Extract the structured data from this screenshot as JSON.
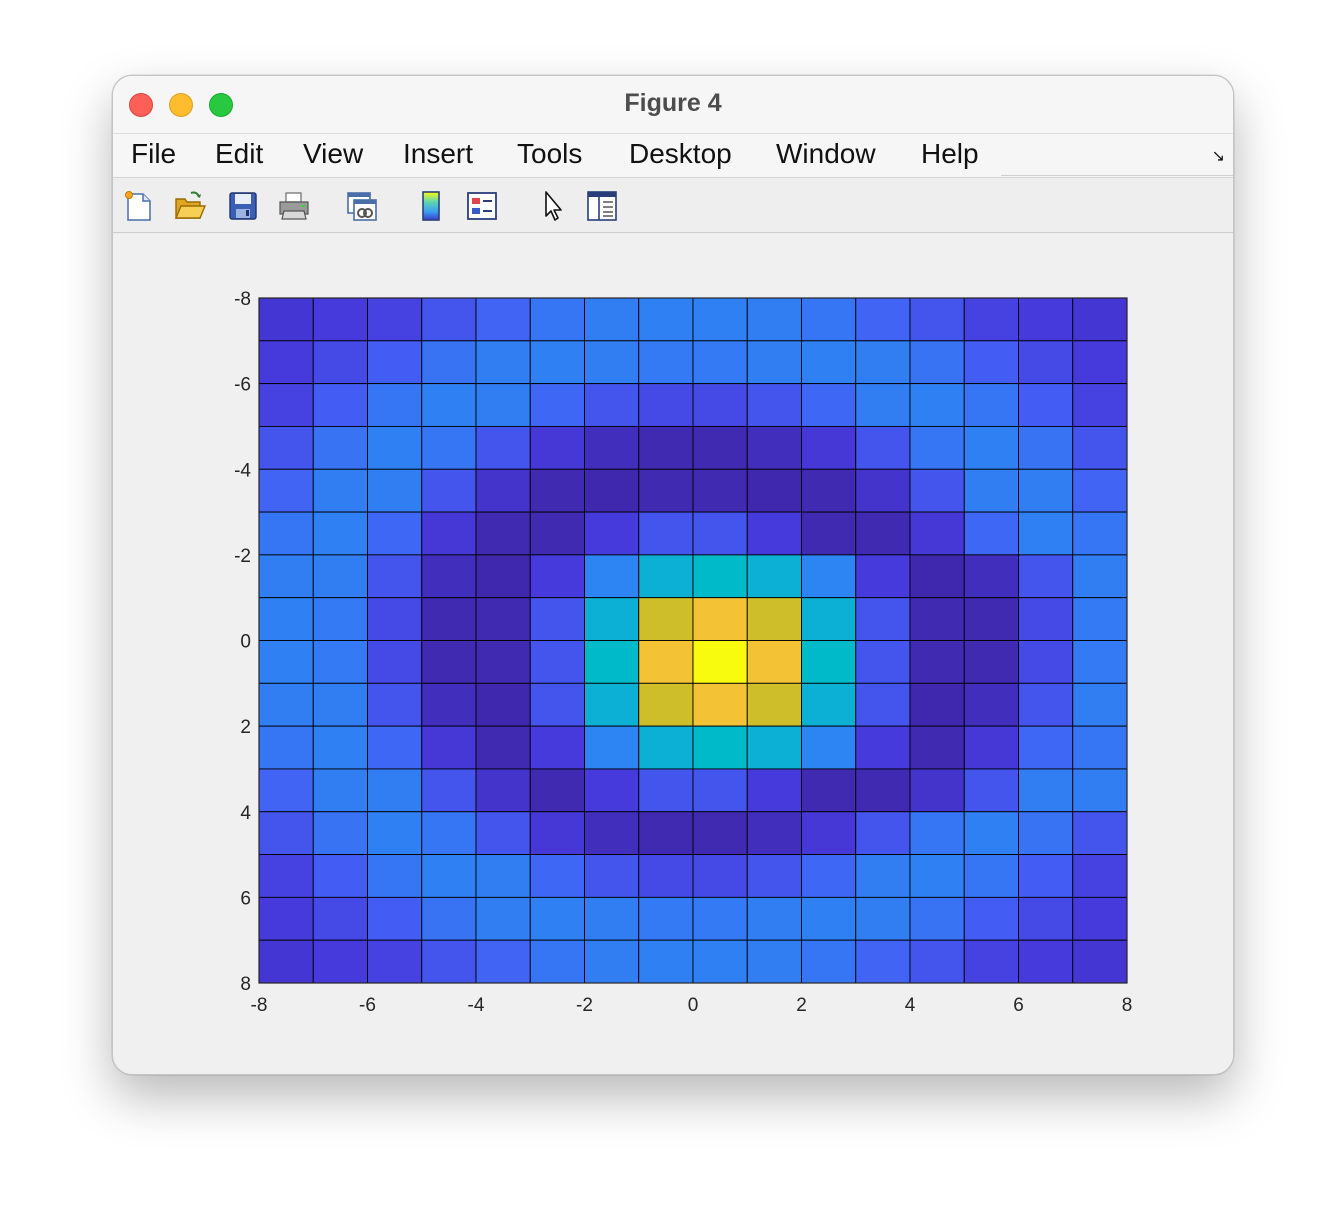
{
  "window": {
    "title": "Figure 4"
  },
  "menu": {
    "items": [
      "File",
      "Edit",
      "View",
      "Insert",
      "Tools",
      "Desktop",
      "Window",
      "Help"
    ]
  },
  "toolbar": {
    "icons": [
      "new-figure-icon",
      "open-file-icon",
      "save-icon",
      "print-icon",
      "link-plot-icon",
      "insert-colorbar-icon",
      "insert-legend-icon",
      "edit-plot-pointer-icon",
      "property-inspector-icon"
    ]
  },
  "chart_data": {
    "type": "heatmap",
    "title": "",
    "xlabel": "",
    "ylabel": "",
    "xlim": [
      -8,
      8
    ],
    "ylim": [
      -8,
      8
    ],
    "y_direction": "reversed",
    "grid": true,
    "colormap": "parula",
    "xticks": [
      -8,
      -6,
      -4,
      -2,
      0,
      2,
      4,
      6,
      8
    ],
    "yticks": [
      -8,
      -6,
      -4,
      -2,
      0,
      2,
      4,
      6,
      8
    ],
    "x_edges": [
      -8,
      -7,
      -6,
      -5,
      -4,
      -3,
      -2,
      -1,
      0,
      1,
      2,
      3,
      4,
      5,
      6,
      7,
      8
    ],
    "y_edges": [
      -8,
      -7,
      -6,
      -5,
      -4,
      -3,
      -2,
      -1,
      0,
      1,
      2,
      3,
      4,
      5,
      6,
      7,
      8
    ],
    "values": [
      [
        0.08,
        0.1,
        0.12,
        0.17,
        0.21,
        0.26,
        0.28,
        0.29,
        0.29,
        0.28,
        0.26,
        0.21,
        0.17,
        0.12,
        0.1,
        0.08
      ],
      [
        0.1,
        0.14,
        0.19,
        0.25,
        0.28,
        0.29,
        0.28,
        0.27,
        0.27,
        0.28,
        0.29,
        0.28,
        0.25,
        0.19,
        0.14,
        0.1
      ],
      [
        0.12,
        0.19,
        0.26,
        0.29,
        0.28,
        0.22,
        0.17,
        0.14,
        0.14,
        0.17,
        0.22,
        0.28,
        0.29,
        0.26,
        0.19,
        0.12
      ],
      [
        0.17,
        0.25,
        0.29,
        0.26,
        0.17,
        0.09,
        0.04,
        0.02,
        0.02,
        0.04,
        0.09,
        0.17,
        0.26,
        0.29,
        0.25,
        0.17
      ],
      [
        0.21,
        0.28,
        0.28,
        0.17,
        0.07,
        0.02,
        0.01,
        0.02,
        0.02,
        0.01,
        0.02,
        0.07,
        0.17,
        0.28,
        0.28,
        0.21
      ],
      [
        0.26,
        0.29,
        0.22,
        0.09,
        0.02,
        0.02,
        0.1,
        0.17,
        0.17,
        0.1,
        0.02,
        0.02,
        0.09,
        0.22,
        0.29,
        0.26
      ],
      [
        0.28,
        0.28,
        0.17,
        0.04,
        0.01,
        0.1,
        0.3,
        0.5,
        0.55,
        0.5,
        0.3,
        0.1,
        0.01,
        0.04,
        0.17,
        0.28
      ],
      [
        0.29,
        0.27,
        0.14,
        0.02,
        0.02,
        0.17,
        0.5,
        0.8,
        0.88,
        0.8,
        0.5,
        0.17,
        0.02,
        0.02,
        0.14,
        0.27
      ],
      [
        0.29,
        0.27,
        0.14,
        0.02,
        0.02,
        0.17,
        0.55,
        0.88,
        1.0,
        0.88,
        0.55,
        0.17,
        0.02,
        0.02,
        0.14,
        0.27
      ],
      [
        0.28,
        0.28,
        0.17,
        0.04,
        0.01,
        0.17,
        0.5,
        0.8,
        0.88,
        0.8,
        0.5,
        0.17,
        0.01,
        0.04,
        0.17,
        0.28
      ],
      [
        0.26,
        0.29,
        0.22,
        0.09,
        0.02,
        0.1,
        0.3,
        0.5,
        0.55,
        0.5,
        0.3,
        0.1,
        0.02,
        0.09,
        0.22,
        0.26
      ],
      [
        0.21,
        0.28,
        0.28,
        0.17,
        0.07,
        0.02,
        0.1,
        0.17,
        0.17,
        0.1,
        0.02,
        0.02,
        0.07,
        0.17,
        0.28,
        0.28
      ],
      [
        0.17,
        0.25,
        0.29,
        0.26,
        0.17,
        0.09,
        0.04,
        0.02,
        0.02,
        0.04,
        0.09,
        0.17,
        0.26,
        0.29,
        0.25,
        0.17
      ],
      [
        0.12,
        0.19,
        0.26,
        0.29,
        0.28,
        0.22,
        0.17,
        0.14,
        0.14,
        0.17,
        0.22,
        0.28,
        0.29,
        0.26,
        0.19,
        0.12
      ],
      [
        0.1,
        0.14,
        0.19,
        0.25,
        0.28,
        0.29,
        0.28,
        0.27,
        0.27,
        0.28,
        0.29,
        0.28,
        0.25,
        0.19,
        0.14,
        0.1
      ],
      [
        0.08,
        0.1,
        0.12,
        0.17,
        0.21,
        0.26,
        0.28,
        0.29,
        0.29,
        0.28,
        0.26,
        0.21,
        0.17,
        0.12,
        0.1,
        0.08
      ]
    ]
  }
}
